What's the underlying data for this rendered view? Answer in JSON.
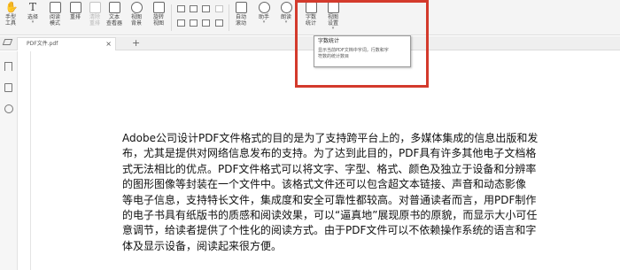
{
  "toolbar": {
    "hand": {
      "label1": "手型",
      "label2": "工具",
      "icon": "hand-icon"
    },
    "select": {
      "label": "选择",
      "icon": "text-cursor-icon"
    },
    "read_mode": {
      "label1": "阅读",
      "label2": "模式",
      "icon": "book-icon"
    },
    "rearrange": {
      "label": "重排",
      "icon": "rearrange-icon"
    },
    "clear_reflow": {
      "label1": "清除",
      "label2": "重排",
      "icon": "clear-reflow-icon"
    },
    "text_reader": {
      "label1": "文本",
      "label2": "查看器",
      "icon": "text-viewer-icon"
    },
    "view_bg": {
      "label1": "视图",
      "label2": "背景",
      "icon": "eye-icon"
    },
    "rotate": {
      "label1": "旋转",
      "label2": "视图",
      "icon": "rotate-icon"
    },
    "auto_scroll": {
      "label1": "自动",
      "label2": "滚动",
      "icon": "auto-scroll-icon"
    },
    "assistant": {
      "label": "助手",
      "icon": "assistant-icon"
    },
    "read_aloud": {
      "label": "朗读",
      "icon": "speaker-icon"
    },
    "word_count": {
      "label1": "字数",
      "label2": "统计",
      "icon": "word-count-icon"
    },
    "view_settings": {
      "label1": "视图",
      "label2": "设置",
      "icon": "view-settings-icon"
    }
  },
  "tab": {
    "title": "PDF文件.pdf",
    "close": "×",
    "add": "+"
  },
  "tooltip": {
    "title": "字数统计",
    "description_line1": "显示当前PDF文档中字词，行数和字",
    "description_line2": "符数的统计数目"
  },
  "highlight_color": "#d33a2c",
  "document": {
    "lines": [
      "Adobe公司设计PDF文件格式的目的是为了支持跨平台上的，多媒体集成的信息出版和发",
      "布，尤其是提供对网络信息发布的支持。为了达到此目的，PDF具有许多其他电子文档格",
      "式无法相比的优点。PDF文件格式可以将文字、字型、格式、颜色及独立于设备和分辨率",
      "的图形图像等封装在一个文件中。该格式文件还可以包含超文本链接、声音和动态影像",
      "等电子信息，支持特长文件，集成度和安全可靠性都较高。对普通读者而言，用PDF制作",
      "的电子书具有纸版书的质感和阅读效果，可以“逼真地”展现原书的原貌，而显示大小可任",
      "意调节，给读者提供了个性化的阅读方式。由于PDF文件可以不依赖操作系统的语言和字",
      "体及显示设备，阅读起来很方便。"
    ]
  }
}
